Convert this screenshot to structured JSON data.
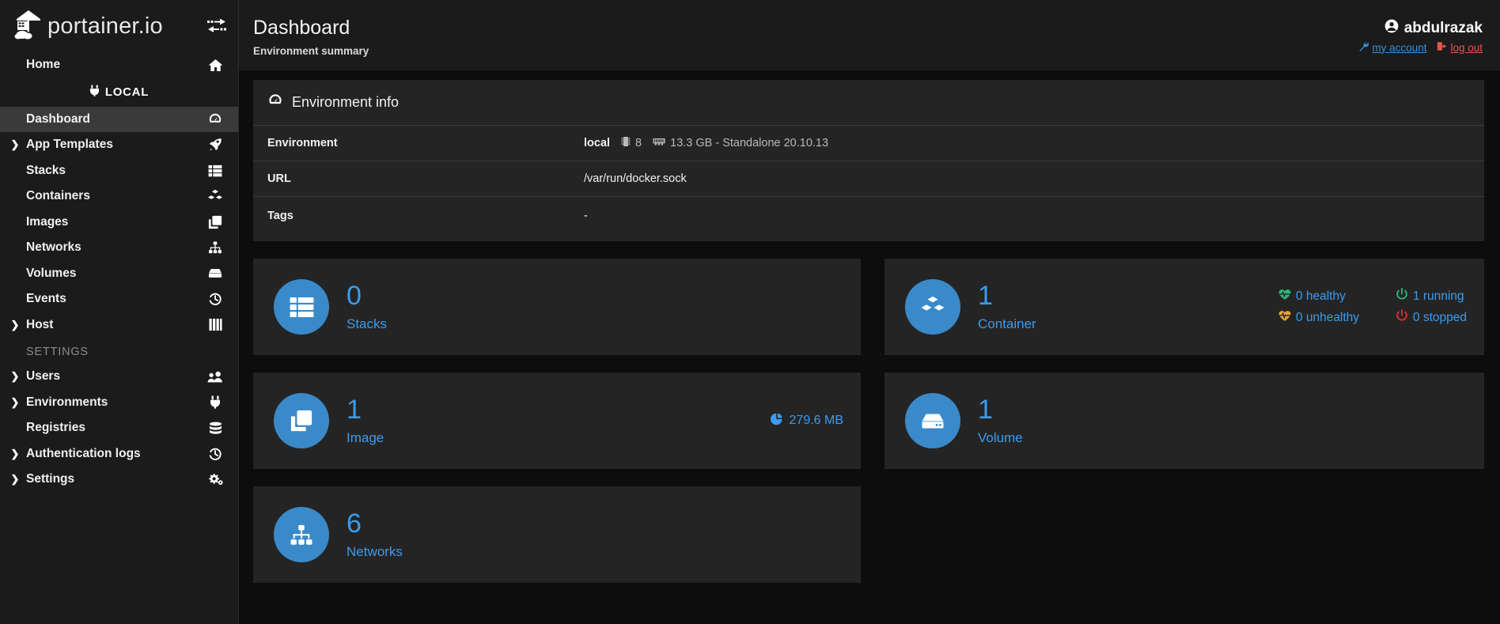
{
  "brand": {
    "name": "portainer.io",
    "toggle_icon": "collapse-sidebar-icon"
  },
  "sidebar": {
    "environment_badge": {
      "label": "LOCAL",
      "icon": "plug-icon"
    },
    "items": [
      {
        "label": "Home",
        "icon": "home-icon",
        "caret": false,
        "active": false
      },
      {
        "label": "Dashboard",
        "icon": "dashboard-icon",
        "caret": false,
        "active": true
      },
      {
        "label": "App Templates",
        "icon": "rocket-icon",
        "caret": true,
        "active": false
      },
      {
        "label": "Stacks",
        "icon": "stacks-icon",
        "caret": false,
        "active": false
      },
      {
        "label": "Containers",
        "icon": "containers-icon",
        "caret": false,
        "active": false
      },
      {
        "label": "Images",
        "icon": "images-icon",
        "caret": false,
        "active": false
      },
      {
        "label": "Networks",
        "icon": "networks-icon",
        "caret": false,
        "active": false
      },
      {
        "label": "Volumes",
        "icon": "volumes-icon",
        "caret": false,
        "active": false
      },
      {
        "label": "Events",
        "icon": "events-icon",
        "caret": false,
        "active": false
      },
      {
        "label": "Host",
        "icon": "host-icon",
        "caret": true,
        "active": false
      }
    ],
    "section_label": "SETTINGS",
    "settings_items": [
      {
        "label": "Users",
        "icon": "users-icon",
        "caret": true
      },
      {
        "label": "Environments",
        "icon": "plug-icon",
        "caret": true
      },
      {
        "label": "Registries",
        "icon": "registries-icon",
        "caret": false
      },
      {
        "label": "Authentication logs",
        "icon": "auth-logs-icon",
        "caret": true
      },
      {
        "label": "Settings",
        "icon": "gear-icon",
        "caret": true
      }
    ]
  },
  "header": {
    "title": "Dashboard",
    "subtitle": "Environment summary",
    "user": "abdulrazak",
    "user_icon": "user-circle-icon",
    "my_account_label": "my account",
    "my_account_icon": "wrench-icon",
    "log_out_label": "log out",
    "log_out_icon": "logout-icon"
  },
  "environment_info": {
    "panel_title": "Environment info",
    "panel_icon": "gauge-icon",
    "rows": [
      {
        "key": "Environment",
        "name": "local",
        "cpu_icon": "cpu-icon",
        "cpu": "8",
        "memory_icon": "memory-icon",
        "memory": "13.3 GB - Standalone 20.10.13"
      },
      {
        "key": "URL",
        "value": "/var/run/docker.sock"
      },
      {
        "key": "Tags",
        "value": "-"
      }
    ]
  },
  "cards": {
    "stacks": {
      "count": "0",
      "label": "Stacks",
      "icon": "stacks-icon"
    },
    "image": {
      "count": "1",
      "label": "Image",
      "icon": "images-icon",
      "size": "279.6 MB",
      "size_icon": "pie-chart-icon"
    },
    "networks": {
      "count": "6",
      "label": "Networks",
      "icon": "networks-icon"
    },
    "container": {
      "count": "1",
      "label": "Container",
      "icon": "containers-icon",
      "stats": [
        {
          "label": "0 healthy",
          "icon": "heartbeat-icon",
          "color": "#2eb87a"
        },
        {
          "label": "1 running",
          "icon": "power-icon",
          "color": "#2eb87a"
        },
        {
          "label": "0 unhealthy",
          "icon": "heartbeat-icon",
          "color": "#e8a33d"
        },
        {
          "label": "0 stopped",
          "icon": "power-icon",
          "color": "#e03131"
        }
      ]
    },
    "volume": {
      "count": "1",
      "label": "Volume",
      "icon": "volumes-icon"
    }
  },
  "colors": {
    "accent": "#3b9cf0",
    "icon_circle": "#3a8ac9",
    "panel": "#242424",
    "sidebar": "#1b1b1b"
  }
}
